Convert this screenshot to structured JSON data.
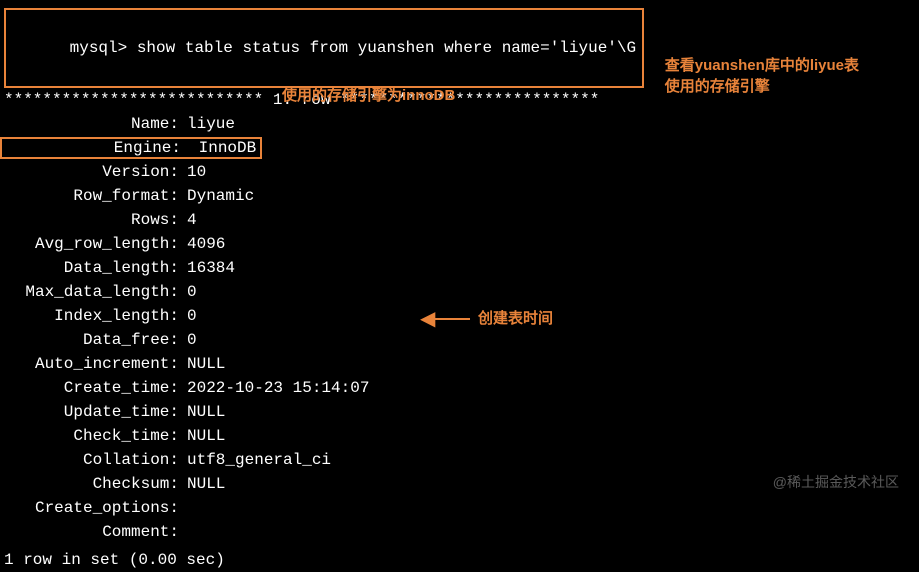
{
  "prompt": "mysql>",
  "command": "show table status from yuanshen where name='liyue'\\G",
  "row_header": "*************************** 1. row ***************************",
  "fields": [
    {
      "label": "Name",
      "value": "liyue"
    },
    {
      "label": "Engine",
      "value": "InnoDB",
      "highlighted": true
    },
    {
      "label": "Version",
      "value": "10"
    },
    {
      "label": "Row_format",
      "value": "Dynamic"
    },
    {
      "label": "Rows",
      "value": "4"
    },
    {
      "label": "Avg_row_length",
      "value": "4096"
    },
    {
      "label": "Data_length",
      "value": "16384"
    },
    {
      "label": "Max_data_length",
      "value": "0"
    },
    {
      "label": "Index_length",
      "value": "0"
    },
    {
      "label": "Data_free",
      "value": "0"
    },
    {
      "label": "Auto_increment",
      "value": "NULL"
    },
    {
      "label": "Create_time",
      "value": "2022-10-23 15:14:07"
    },
    {
      "label": "Update_time",
      "value": "NULL"
    },
    {
      "label": "Check_time",
      "value": "NULL"
    },
    {
      "label": "Collation",
      "value": "utf8_general_ci"
    },
    {
      "label": "Checksum",
      "value": "NULL"
    },
    {
      "label": "Create_options",
      "value": ""
    },
    {
      "label": "Comment",
      "value": ""
    }
  ],
  "footer": "1 row in set (0.00 sec)",
  "annotations": {
    "ann1_line1": "查看yuanshen库中的liyue表",
    "ann1_line2": "使用的存储引擎",
    "ann2": "使用的存储引擎为innoDB",
    "ann3": "创建表时间"
  },
  "watermark": "@稀土掘金技术社区",
  "colors": {
    "highlight": "#e8833a",
    "bg": "#000000",
    "fg": "#ffffff"
  }
}
